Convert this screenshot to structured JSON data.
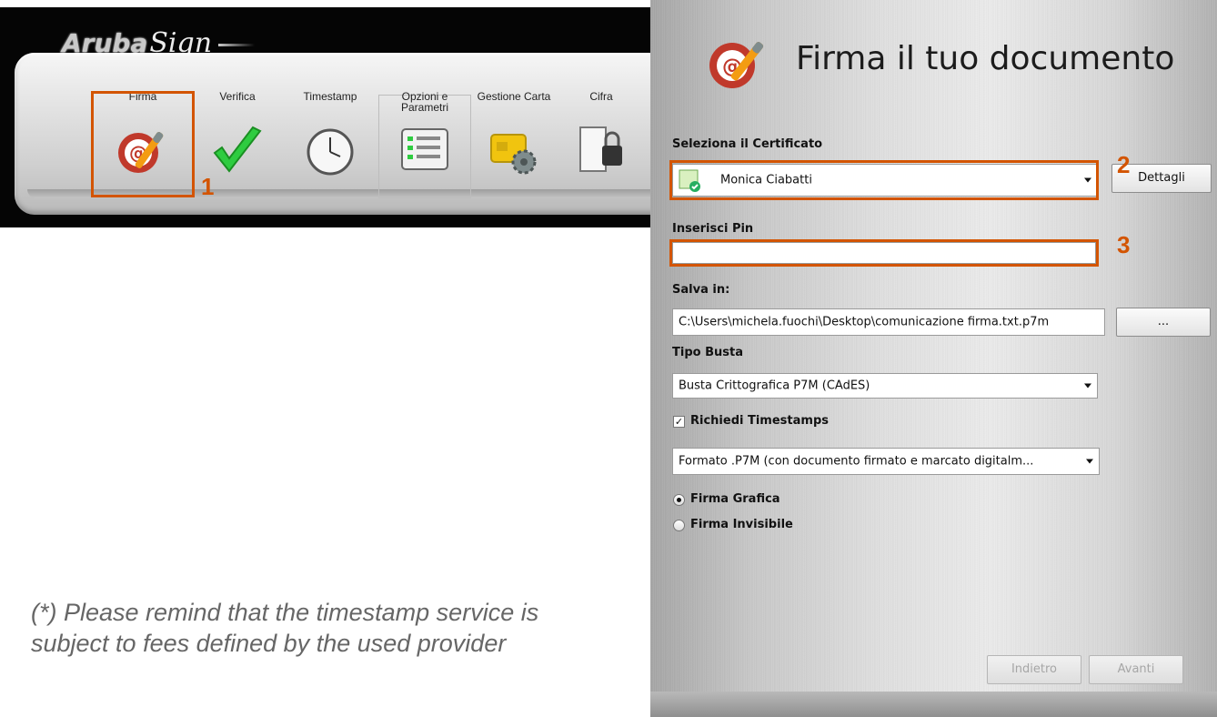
{
  "toolbar": {
    "brand": {
      "first": "Aruba",
      "second": "Sign"
    },
    "items": [
      {
        "id": "firma",
        "label": "Firma",
        "icon": "signature-pen-icon"
      },
      {
        "id": "verifica",
        "label": "Verifica",
        "icon": "checkmark-icon"
      },
      {
        "id": "timestamp",
        "label": "Timestamp",
        "icon": "clock-icon"
      },
      {
        "id": "opzioni",
        "label": "Opzioni e Parametri",
        "icon": "options-form-icon"
      },
      {
        "id": "gestione",
        "label": "Gestione Carta",
        "icon": "smartcard-gear-icon"
      },
      {
        "id": "cifra",
        "label": "Cifra",
        "icon": "file-lock-icon"
      }
    ]
  },
  "markers": {
    "m1": "1",
    "m2": "2",
    "m3": "3"
  },
  "note": "(*) Please remind that the timestamp service is subject to fees defined by the used provider",
  "dialog": {
    "title": "Firma il tuo documento",
    "certificate": {
      "label": "Seleziona il Certificato",
      "value": "Monica Ciabatti",
      "details_button": "Dettagli"
    },
    "pin": {
      "label": "Inserisci Pin",
      "value": ""
    },
    "save": {
      "label": "Salva in:",
      "value": "C:\\Users\\michela.fuochi\\Desktop\\comunicazione firma.txt.p7m",
      "browse_button": "..."
    },
    "envelope": {
      "label": "Tipo Busta",
      "value": "Busta Crittografica P7M (CAdES)"
    },
    "timestamps": {
      "label": "Richiedi Timestamps",
      "checked": true
    },
    "format": {
      "value": "Formato .P7M (con documento firmato e marcato digitalm..."
    },
    "signature_type": {
      "options": [
        "Firma Grafica",
        "Firma Invisibile"
      ],
      "selected": "Firma Grafica"
    },
    "buttons": {
      "back": "Indietro",
      "next": "Avanti"
    }
  },
  "colors": {
    "highlight": "#d35400",
    "toolbar_bg": "#050505",
    "note_text": "#666666"
  }
}
